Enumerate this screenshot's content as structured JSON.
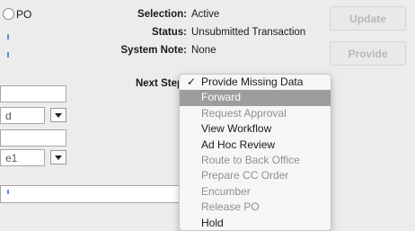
{
  "po_option": {
    "label": "PO"
  },
  "info": {
    "selection": {
      "label": "Selection:",
      "value": "Active"
    },
    "status": {
      "label": "Status:",
      "value": "Unsubmitted Transaction"
    },
    "system_note": {
      "label": "System Note:",
      "value": "None"
    },
    "next_step": {
      "label": "Next Step"
    }
  },
  "buttons": {
    "update": "Update",
    "provide": "Provide"
  },
  "left_fields": {
    "select1_value": "d",
    "select2_value": "e1"
  },
  "menu": {
    "items": [
      {
        "label": "Provide Missing Data",
        "checked": true,
        "state": "enabled"
      },
      {
        "label": "Forward",
        "state": "highlighted"
      },
      {
        "label": "Request Approval",
        "state": "disabled"
      },
      {
        "label": "View Workflow",
        "state": "enabled"
      },
      {
        "label": "Ad Hoc Review",
        "state": "enabled"
      },
      {
        "label": "Route to Back Office",
        "state": "disabled"
      },
      {
        "label": "Prepare CC Order",
        "state": "disabled"
      },
      {
        "label": "Encumber",
        "state": "disabled"
      },
      {
        "label": "Release PO",
        "state": "disabled"
      },
      {
        "label": "Hold",
        "state": "enabled"
      }
    ]
  },
  "colors": {
    "menu_highlight": "#9d9d9d",
    "disabled_text": "#8f8f8f",
    "button_text_disabled": "#b8b8b8"
  }
}
